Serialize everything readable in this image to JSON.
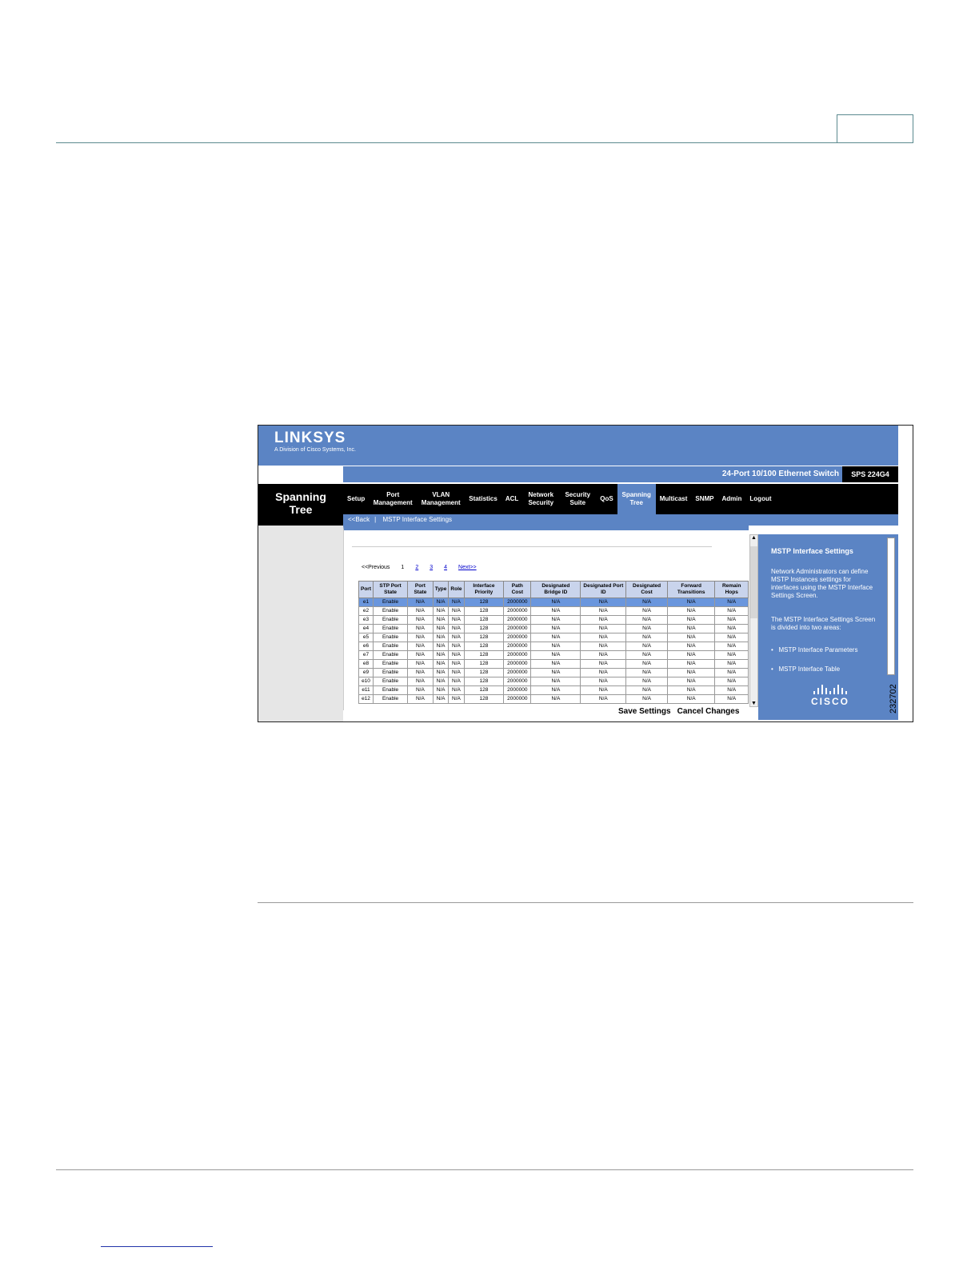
{
  "brand": {
    "logo": "LINKSYS",
    "tagline": "A Division of Cisco Systems, Inc."
  },
  "titlebar": {
    "device": "24-Port 10/100 Ethernet Switch",
    "model": "SPS 224G4"
  },
  "section": {
    "line1": "Spanning",
    "line2": "Tree"
  },
  "nav": [
    {
      "label": "Setup"
    },
    {
      "label": "Port Management"
    },
    {
      "label": "VLAN Management"
    },
    {
      "label": "Statistics"
    },
    {
      "label": "ACL"
    },
    {
      "label": "Network Security"
    },
    {
      "label": "Security Suite"
    },
    {
      "label": "QoS"
    },
    {
      "label": "Spanning Tree"
    },
    {
      "label": "Multicast"
    },
    {
      "label": "SNMP"
    },
    {
      "label": "Admin"
    },
    {
      "label": "Logout"
    }
  ],
  "subnav": {
    "back": "<<Back",
    "current": "MSTP Interface Settings"
  },
  "pager": {
    "prev": "<<Previous",
    "p1": "1",
    "p2": "2",
    "p3": "3",
    "p4": "4",
    "next": "Next>>"
  },
  "table": {
    "headers": [
      "Port",
      "STP Port State",
      "Port State",
      "Type",
      "Role",
      "Interface Priority",
      "Path Cost",
      "Designated Bridge ID",
      "Designated Port ID",
      "Designated Cost",
      "Forward Transitions",
      "Remain Hops"
    ],
    "rows": [
      [
        "e1",
        "Enable",
        "N/A",
        "N/A",
        "N/A",
        "128",
        "2000000",
        "N/A",
        "N/A",
        "N/A",
        "N/A",
        "N/A"
      ],
      [
        "e2",
        "Enable",
        "N/A",
        "N/A",
        "N/A",
        "128",
        "2000000",
        "N/A",
        "N/A",
        "N/A",
        "N/A",
        "N/A"
      ],
      [
        "e3",
        "Enable",
        "N/A",
        "N/A",
        "N/A",
        "128",
        "2000000",
        "N/A",
        "N/A",
        "N/A",
        "N/A",
        "N/A"
      ],
      [
        "e4",
        "Enable",
        "N/A",
        "N/A",
        "N/A",
        "128",
        "2000000",
        "N/A",
        "N/A",
        "N/A",
        "N/A",
        "N/A"
      ],
      [
        "e5",
        "Enable",
        "N/A",
        "N/A",
        "N/A",
        "128",
        "2000000",
        "N/A",
        "N/A",
        "N/A",
        "N/A",
        "N/A"
      ],
      [
        "e6",
        "Enable",
        "N/A",
        "N/A",
        "N/A",
        "128",
        "2000000",
        "N/A",
        "N/A",
        "N/A",
        "N/A",
        "N/A"
      ],
      [
        "e7",
        "Enable",
        "N/A",
        "N/A",
        "N/A",
        "128",
        "2000000",
        "N/A",
        "N/A",
        "N/A",
        "N/A",
        "N/A"
      ],
      [
        "e8",
        "Enable",
        "N/A",
        "N/A",
        "N/A",
        "128",
        "2000000",
        "N/A",
        "N/A",
        "N/A",
        "N/A",
        "N/A"
      ],
      [
        "e9",
        "Enable",
        "N/A",
        "N/A",
        "N/A",
        "128",
        "2000000",
        "N/A",
        "N/A",
        "N/A",
        "N/A",
        "N/A"
      ],
      [
        "e10",
        "Enable",
        "N/A",
        "N/A",
        "N/A",
        "128",
        "2000000",
        "N/A",
        "N/A",
        "N/A",
        "N/A",
        "N/A"
      ],
      [
        "e11",
        "Enable",
        "N/A",
        "N/A",
        "N/A",
        "128",
        "2000000",
        "N/A",
        "N/A",
        "N/A",
        "N/A",
        "N/A"
      ],
      [
        "e12",
        "Enable",
        "N/A",
        "N/A",
        "N/A",
        "128",
        "2000000",
        "N/A",
        "N/A",
        "N/A",
        "N/A",
        "N/A"
      ]
    ]
  },
  "buttons": {
    "save": "Save Settings",
    "cancel": "Cancel Changes"
  },
  "help": {
    "title": "MSTP Interface Settings",
    "p1": "Network Administrators can define MSTP Instances settings for interfaces using the MSTP Interface Settings Screen.",
    "p2": "The MSTP Interface Settings Screen is divided into two areas:",
    "b1": "MSTP Interface Parameters",
    "b2": "MSTP Interface Table",
    "logo": "CISCO"
  },
  "figure_id": "232702",
  "colors": {
    "banner": "#5b84c4",
    "nav": "#000000",
    "selected_row": "#6a96dd"
  }
}
